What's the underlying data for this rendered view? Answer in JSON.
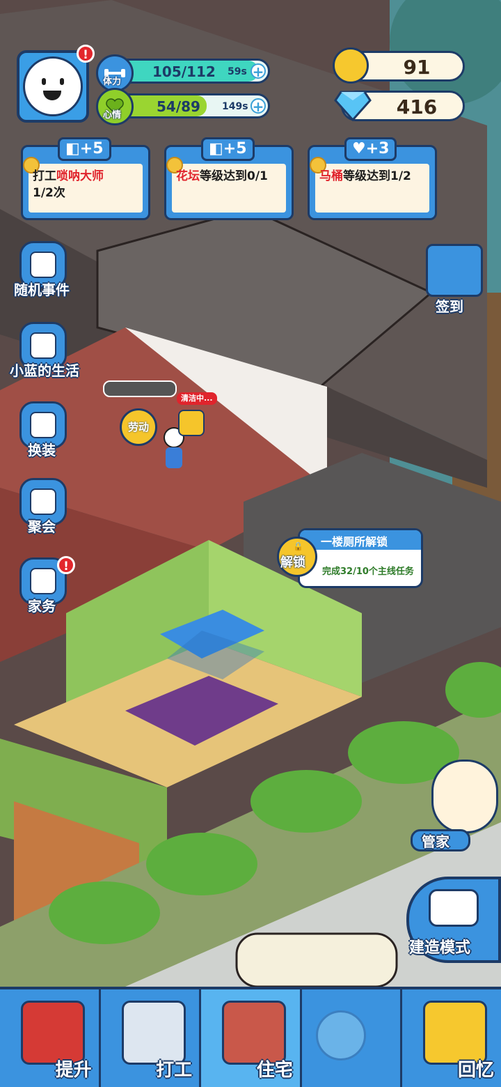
{
  "hud": {
    "stamina": {
      "label": "体力",
      "value": "105/112",
      "timer": "59s",
      "fill_fraction": 0.94
    },
    "mood": {
      "label": "心情",
      "value": "54/89",
      "timer": "149s",
      "fill_fraction": 0.61
    },
    "gold": "91",
    "diamonds": "416",
    "avatar_alert": "!"
  },
  "tasks": [
    {
      "reward": "+5",
      "reward_icon": "dumbbell-icon",
      "text_pre": "打工",
      "text_highlight": "唢呐大师",
      "text_post": "1/2次"
    },
    {
      "reward": "+5",
      "reward_icon": "dumbbell-icon",
      "text_pre": "",
      "text_highlight": "花坛",
      "text_post": "等级达到0/1"
    },
    {
      "reward": "+3",
      "reward_icon": "heart-icon",
      "text_pre": "",
      "text_highlight": "马桶",
      "text_post": "等级达到1/2"
    }
  ],
  "side_menu": [
    {
      "label": "随机事件",
      "icon": "notepad-icon"
    },
    {
      "label": "小蓝的生活",
      "icon": "portrait-icon"
    },
    {
      "label": "换装",
      "icon": "shirt-icon"
    },
    {
      "label": "聚会",
      "icon": "party-popper-icon"
    },
    {
      "label": "家务",
      "icon": "vacuum-icon",
      "alert": "!"
    }
  ],
  "right_menu": {
    "checkin": "签到",
    "butler": "管家",
    "build_mode": "建造模式"
  },
  "scene": {
    "work_tag": "劳动",
    "cleaning_bubble": "清洁中...",
    "unlock": {
      "button": "解锁",
      "title": "一楼厕所解锁",
      "desc": "完成32/10个主线任务"
    }
  },
  "bottom_nav": [
    {
      "label": "提升",
      "icon": "book-icon"
    },
    {
      "label": "打工",
      "icon": "computer-icon"
    },
    {
      "label": "住宅",
      "icon": "house-icon",
      "active": true
    },
    {
      "label": "",
      "icon": "lock-icon"
    },
    {
      "label": "回忆",
      "icon": "camera-icon"
    }
  ],
  "colors": {
    "accent": "#3b93df",
    "outline": "#1d3b67",
    "alert": "#e3262c",
    "stamina": "#3fd6c0",
    "mood": "#9ad531"
  }
}
